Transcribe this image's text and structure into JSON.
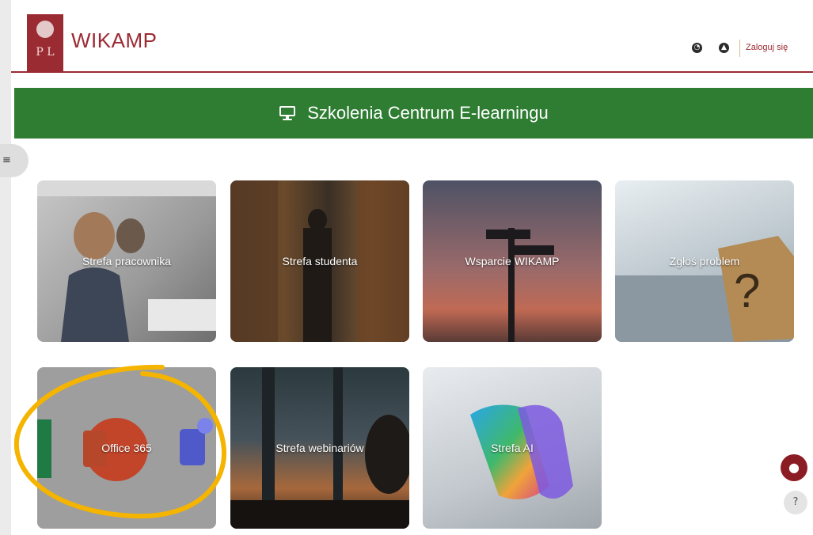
{
  "header": {
    "brand": "WIKAMP",
    "logo_letters": "P L",
    "login_label": "Zaloguj się",
    "icons": [
      "language-icon",
      "accessibility-icon"
    ]
  },
  "banner": {
    "icon": "monitor-icon",
    "title": "Szkolenia Centrum E-learningu",
    "color": "#2e7d32"
  },
  "tiles": [
    {
      "label": "Strefa pracownika"
    },
    {
      "label": "Strefa studenta"
    },
    {
      "label": "Wsparcie WIKAMP"
    },
    {
      "label": "Zgłoś problem"
    },
    {
      "label": "Office 365"
    },
    {
      "label": "Strefa webinariów"
    },
    {
      "label": "Strefa AI"
    }
  ],
  "help": {
    "question_mark": "?"
  },
  "colors": {
    "brand": "#9b2b33",
    "annotation": "#f5b400"
  }
}
